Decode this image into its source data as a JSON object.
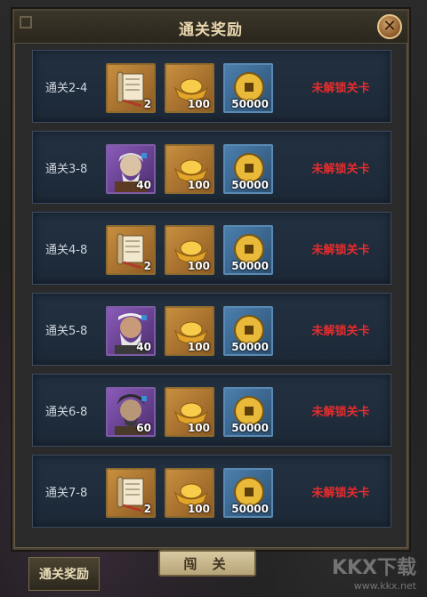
{
  "panel": {
    "title": "通关奖励",
    "close_icon": "close-icon"
  },
  "rows": [
    {
      "stage": "通关2-4",
      "rewards": [
        {
          "icon": "scroll-icon",
          "count": "2"
        },
        {
          "icon": "gold-ingot-icon",
          "count": "100"
        },
        {
          "icon": "copper-coin-icon",
          "count": "50000"
        }
      ],
      "status": "未解锁关卡"
    },
    {
      "stage": "通关3-8",
      "rewards": [
        {
          "icon": "hero-portrait-icon",
          "count": "40"
        },
        {
          "icon": "gold-ingot-icon",
          "count": "100"
        },
        {
          "icon": "copper-coin-icon",
          "count": "50000"
        }
      ],
      "status": "未解锁关卡"
    },
    {
      "stage": "通关4-8",
      "rewards": [
        {
          "icon": "scroll-icon",
          "count": "2"
        },
        {
          "icon": "gold-ingot-icon",
          "count": "100"
        },
        {
          "icon": "copper-coin-icon",
          "count": "50000"
        }
      ],
      "status": "未解锁关卡"
    },
    {
      "stage": "通关5-8",
      "rewards": [
        {
          "icon": "hero-portrait-icon",
          "count": "40"
        },
        {
          "icon": "gold-ingot-icon",
          "count": "100"
        },
        {
          "icon": "copper-coin-icon",
          "count": "50000"
        }
      ],
      "status": "未解锁关卡"
    },
    {
      "stage": "通关6-8",
      "rewards": [
        {
          "icon": "hero-portrait-icon",
          "count": "60"
        },
        {
          "icon": "gold-ingot-icon",
          "count": "100"
        },
        {
          "icon": "copper-coin-icon",
          "count": "50000"
        }
      ],
      "status": "未解锁关卡"
    },
    {
      "stage": "通关7-8",
      "rewards": [
        {
          "icon": "scroll-icon",
          "count": "2"
        },
        {
          "icon": "gold-ingot-icon",
          "count": "100"
        },
        {
          "icon": "copper-coin-icon",
          "count": "50000"
        }
      ],
      "status": "未解锁关卡"
    }
  ],
  "bottom": {
    "tab_label": "通关奖励",
    "plaque_label": "闯 关"
  },
  "watermark": {
    "brand": "KKX下载",
    "url": "www.kkx.net"
  },
  "colors": {
    "status_locked": "#e62d2d",
    "title": "#ead7ae"
  }
}
